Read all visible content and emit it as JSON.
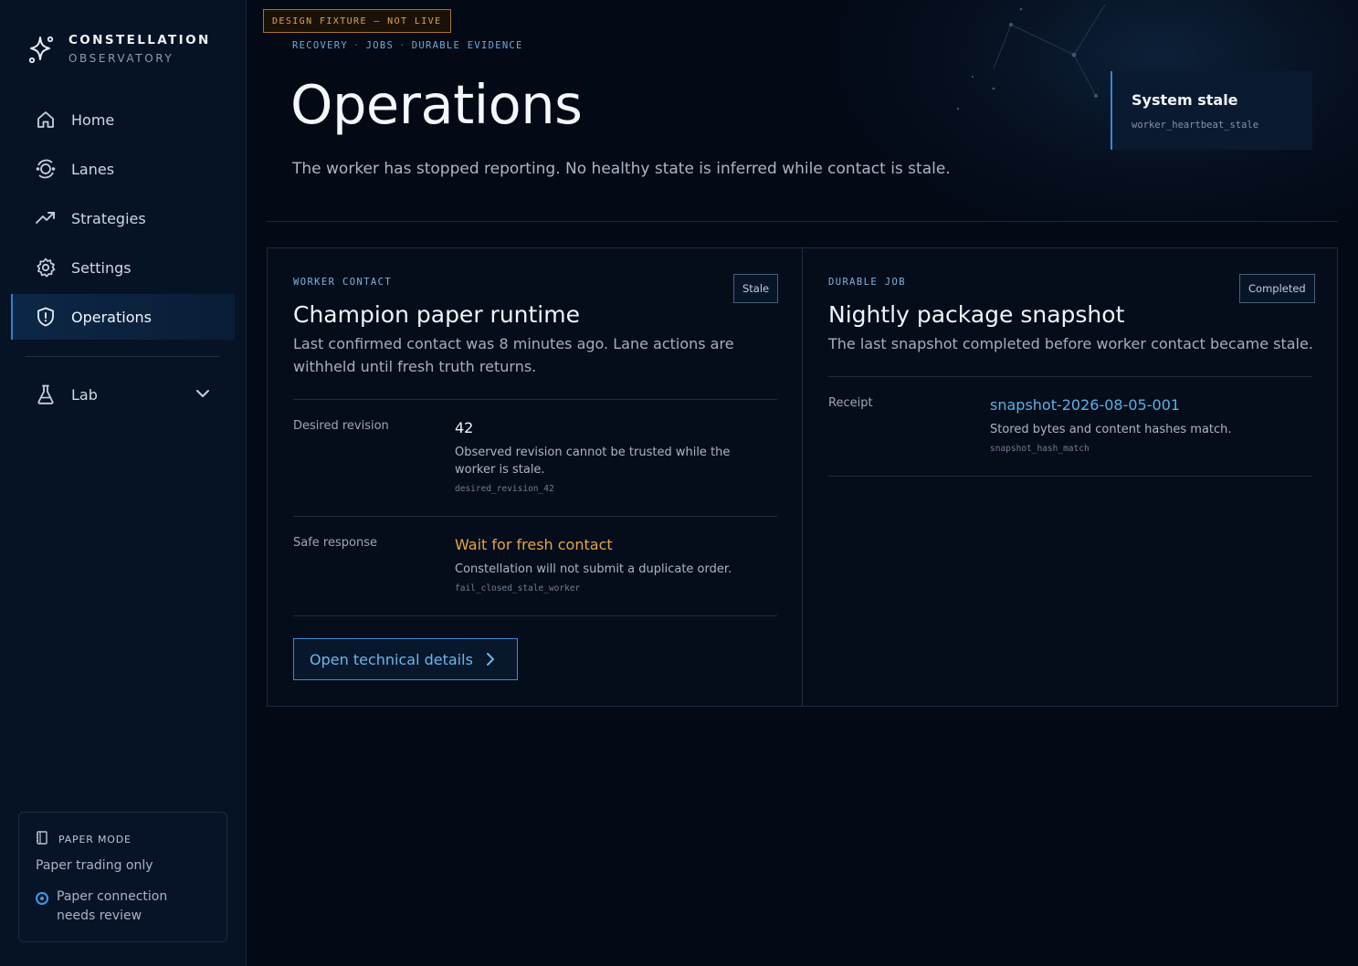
{
  "brand": {
    "name": "CONSTELLATION",
    "subtitle": "OBSERVATORY"
  },
  "sidebar": {
    "items": [
      {
        "label": "Home",
        "icon": "home-icon"
      },
      {
        "label": "Lanes",
        "icon": "lanes-icon"
      },
      {
        "label": "Strategies",
        "icon": "trending-icon"
      },
      {
        "label": "Settings",
        "icon": "gear-icon"
      },
      {
        "label": "Operations",
        "icon": "shield-icon",
        "active": true
      }
    ],
    "lab": {
      "label": "Lab",
      "icon": "flask-icon",
      "expanded": false
    },
    "paper_mode": {
      "label": "PAPER MODE",
      "status": "Paper trading only",
      "review": "Paper connection needs review"
    }
  },
  "fixture_badge": "DESIGN FIXTURE — NOT LIVE",
  "breadcrumb": [
    "RECOVERY",
    "JOBS",
    "DURABLE EVIDENCE"
  ],
  "page": {
    "title": "Operations",
    "subtitle": "The worker has stopped reporting. No healthy state is inferred while contact is stale."
  },
  "system_status": {
    "title": "System stale",
    "code": "worker_heartbeat_stale"
  },
  "worker_panel": {
    "eyebrow": "WORKER CONTACT",
    "badge": "Stale",
    "title": "Champion paper runtime",
    "description": "Last confirmed contact was 8 minutes ago. Lane actions are withheld until fresh truth returns.",
    "rows": [
      {
        "label": "Desired revision",
        "value": "42",
        "note": "Observed revision cannot be trusted while the worker is stale.",
        "code": "desired_revision_42"
      },
      {
        "label": "Safe response",
        "value": "Wait for fresh contact",
        "note": "Constellation will not submit a duplicate order.",
        "code": "fail_closed_stale_worker"
      }
    ],
    "button": "Open technical details"
  },
  "job_panel": {
    "eyebrow": "DURABLE JOB",
    "badge": "Completed",
    "title": "Nightly package snapshot",
    "description": "The last snapshot completed before worker contact became stale.",
    "rows": [
      {
        "label": "Receipt",
        "value": "snapshot-2026-08-05-001",
        "note": "Stored bytes and content hashes match.",
        "code": "snapshot_hash_match"
      }
    ]
  },
  "colors": {
    "background": "#030915",
    "accent": "#3d8ad6",
    "warning": "#e6a445",
    "fixture": "#e1a24a"
  }
}
